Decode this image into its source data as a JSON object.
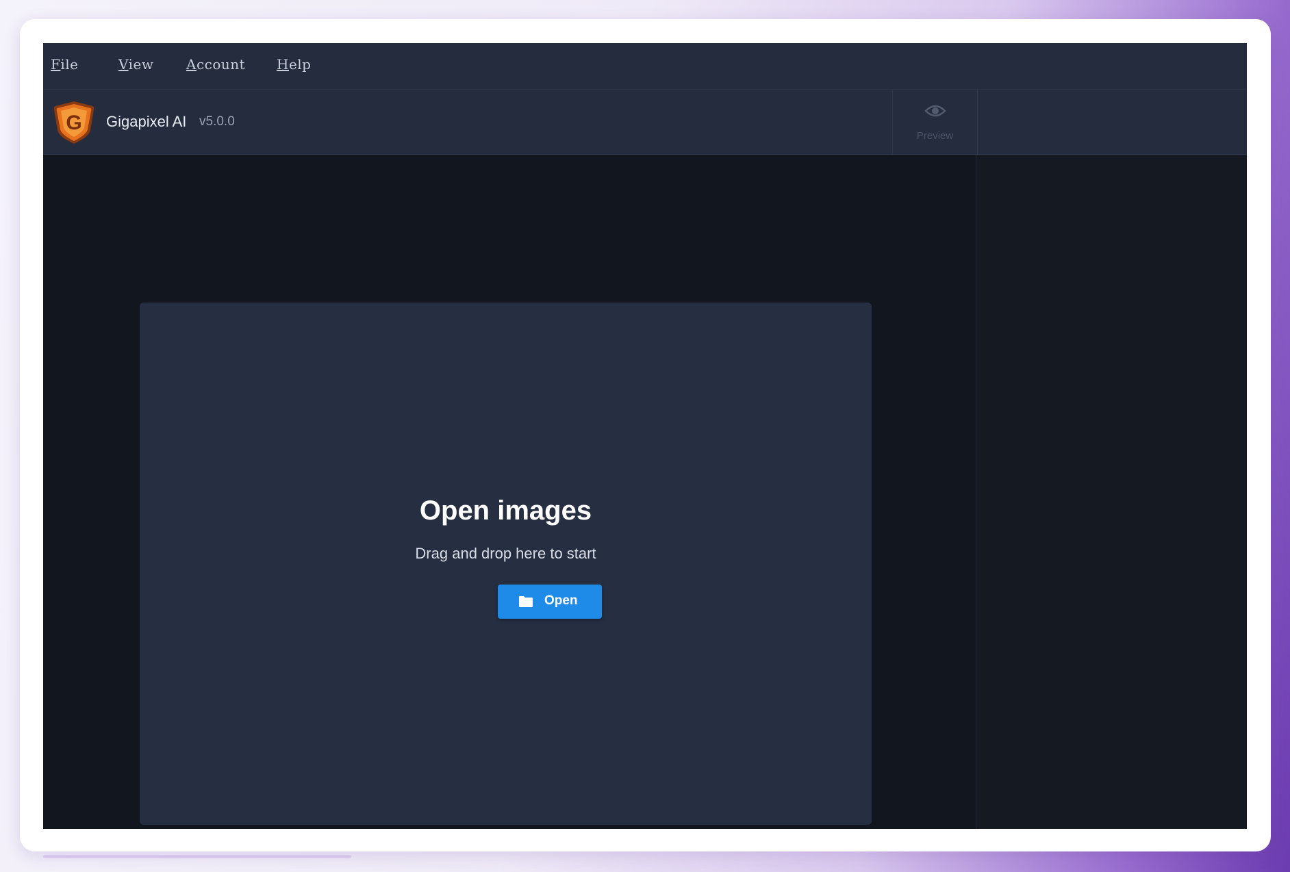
{
  "menu": {
    "file": {
      "accel": "F",
      "rest": "ile"
    },
    "view": {
      "accel": "V",
      "rest": "iew"
    },
    "account": {
      "accel": "A",
      "rest": "ccount"
    },
    "help": {
      "accel": "H",
      "rest": "elp"
    }
  },
  "header": {
    "app_name": "Gigapixel AI",
    "version": "v5.0.0",
    "logo_letter": "G",
    "preview_label": "Preview"
  },
  "dropzone": {
    "title": "Open images",
    "subtitle": "Drag and drop here to start",
    "open_label": "Open"
  },
  "colors": {
    "accent": "#1f8be8",
    "logo_orange": "#e8731f",
    "background": "#12161f",
    "panel": "#252c3e"
  },
  "icons": {
    "logo": "gigapixel-logo-icon",
    "preview": "eye-icon",
    "open": "folder-icon"
  }
}
